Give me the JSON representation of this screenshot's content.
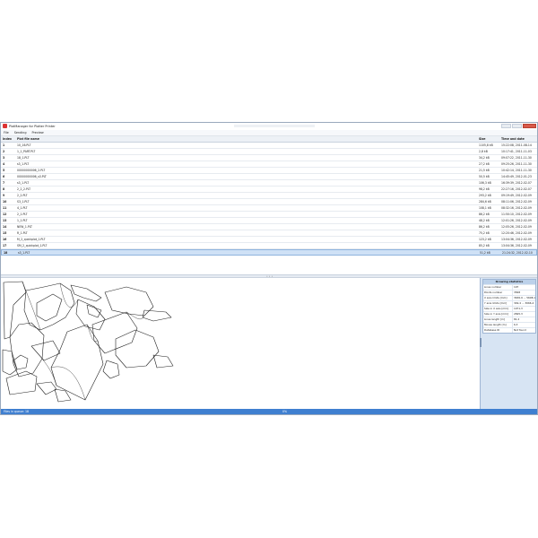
{
  "window": {
    "title": "PlotManager",
    "title_suffix": "for Plotter Printer",
    "menu": [
      "File",
      "Sending",
      "Preview"
    ]
  },
  "table": {
    "columns": [
      "Index",
      "Plot file name",
      "Size",
      "Time and date"
    ],
    "rows": [
      {
        "index": "1",
        "name": "10_16.PLT",
        "size": "1105,8 kB",
        "time": "15:22:08, 2011-08-14"
      },
      {
        "index": "2",
        "name": "1_1_PART.PLT",
        "size": "2,8 kB",
        "time": "10:17:41, 2011-11-03"
      },
      {
        "index": "3",
        "name": "18_1.PLT",
        "size": "34,2 kB",
        "time": "09:07:22, 2011-11-30"
      },
      {
        "index": "4",
        "name": "s3_1.PLT",
        "size": "27,2 kB",
        "time": "09:25:26, 2011-11-30"
      },
      {
        "index": "5",
        "name": "00000000006_2.PLT",
        "size": "21,5 kB",
        "time": "10:42:14, 2011-11-30"
      },
      {
        "index": "6",
        "name": "00000000006_s3.PLT",
        "size": "50,5 kB",
        "time": "14:45:49, 2012-01-23"
      },
      {
        "index": "7",
        "name": "s3_1.PLT",
        "size": "106,3 kB",
        "time": "16:39:39, 2012-02-07"
      },
      {
        "index": "8",
        "name": "2_2_2.PLT",
        "size": "98,2 kB",
        "time": "22:27:16, 2012-02-07"
      },
      {
        "index": "9",
        "name": "2_2.PLT",
        "size": "293,2 kB",
        "time": "09:19:49, 2012-02-09"
      },
      {
        "index": "10",
        "name": "S3_1.PLT",
        "size": "284,6 kB",
        "time": "08:11:06, 2012-02-09"
      },
      {
        "index": "11",
        "name": "4_1.PLT",
        "size": "108,1 kB",
        "time": "08:32:16, 2012-02-09"
      },
      {
        "index": "12",
        "name": "2_1.PLT",
        "size": "86,2 kB",
        "time": "11:50:10, 2012-02-09"
      },
      {
        "index": "13",
        "name": "1_1.PLT",
        "size": "48,2 kB",
        "time": "12:01:26, 2012-02-09"
      },
      {
        "index": "14",
        "name": "NEW_1.PLT",
        "size": "86,2 kB",
        "time": "12:05:26, 2012-02-09"
      },
      {
        "index": "15",
        "name": "R_1.PLT",
        "size": "75,2 kB",
        "time": "12:20:46, 2012-02-09"
      },
      {
        "index": "16",
        "name": "M_2_quickplot_1.PLT",
        "size": "123,2 kB",
        "time": "13:04:36, 2012-02-09"
      },
      {
        "index": "17",
        "name": "SM_2_quickplot_1.PLT",
        "size": "85,2 kB",
        "time": "13:04:36, 2012-02-09"
      },
      {
        "index": "18",
        "name": "s3_1.PLT",
        "size": "51,2 kB",
        "time": "21:24:32, 2012-02-10"
      }
    ]
  },
  "stats": {
    "title": "Drawing statistics",
    "items": [
      {
        "label": "Lines number",
        "value": "197"
      },
      {
        "label": "Points number",
        "value": "3568"
      },
      {
        "label": "X axis limits [mm]",
        "value": "3636,9 ... 5608,1"
      },
      {
        "label": "Y axis limits [mm]",
        "value": "349,4 ... 3066,4"
      },
      {
        "label": "Size in X axis [mm]",
        "value": "1971,3"
      },
      {
        "label": "Size in Y axis [mm]",
        "value": "2695,3"
      },
      {
        "label": "Lines length [m]",
        "value": "81,2"
      },
      {
        "label": "Moves length [m]",
        "value": "6,3"
      },
      {
        "label": "Database ID",
        "value": "Not found"
      }
    ]
  },
  "statusbar": {
    "left": "Files in queue: 18",
    "center": "0%"
  }
}
